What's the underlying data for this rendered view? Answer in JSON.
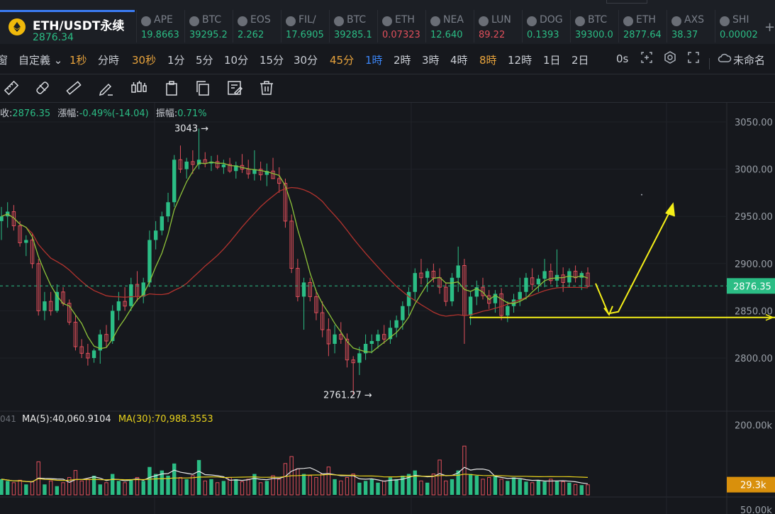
{
  "symbol": {
    "name": "ETH/USDT永续",
    "price": "2876.34"
  },
  "tickers": [
    {
      "name": "APE",
      "price": "19.8663",
      "dir": "up"
    },
    {
      "name": "BTC",
      "price": "39295.2",
      "dir": "up"
    },
    {
      "name": "EOS",
      "price": "2.262",
      "dir": "up"
    },
    {
      "name": "FIL/",
      "price": "17.6905",
      "dir": "up"
    },
    {
      "name": "BTC",
      "price": "39285.1",
      "dir": "up"
    },
    {
      "name": "ETH",
      "price": "0.07323",
      "dir": "down"
    },
    {
      "name": "NEA",
      "price": "12.640",
      "dir": "up"
    },
    {
      "name": "LUN",
      "price": "89.22",
      "dir": "down"
    },
    {
      "name": "DOG",
      "price": "0.1393",
      "dir": "up"
    },
    {
      "name": "BTC",
      "price": "39300.0",
      "dir": "up"
    },
    {
      "name": "ETH",
      "price": "2877.64",
      "dir": "up"
    },
    {
      "name": "AXS",
      "price": "38.37",
      "dir": "up"
    },
    {
      "name": "SHI",
      "price": "0.00002",
      "dir": "up"
    }
  ],
  "intervals": [
    {
      "label": "窗",
      "state": "normal"
    },
    {
      "label": "自定義",
      "state": "normal"
    },
    {
      "label": "1秒",
      "state": "fav"
    },
    {
      "label": "分時",
      "state": "normal"
    },
    {
      "label": "30秒",
      "state": "fav"
    },
    {
      "label": "1分",
      "state": "normal"
    },
    {
      "label": "5分",
      "state": "normal"
    },
    {
      "label": "10分",
      "state": "normal"
    },
    {
      "label": "15分",
      "state": "normal"
    },
    {
      "label": "30分",
      "state": "normal"
    },
    {
      "label": "45分",
      "state": "fav"
    },
    {
      "label": "1時",
      "state": "active"
    },
    {
      "label": "2時",
      "state": "normal"
    },
    {
      "label": "3時",
      "state": "normal"
    },
    {
      "label": "4時",
      "state": "normal"
    },
    {
      "label": "8時",
      "state": "fav"
    },
    {
      "label": "12時",
      "state": "normal"
    },
    {
      "label": "1日",
      "state": "normal"
    },
    {
      "label": "2日",
      "state": "normal"
    },
    {
      "label": "0s",
      "state": "normal"
    }
  ],
  "layout_name": "未命名",
  "tools": [
    "ruler-icon",
    "ruler-alt-icon",
    "measure-icon",
    "pencil-icon",
    "candles-icon",
    "clipboard-icon",
    "copy-icon",
    "edit-icon",
    "trash-icon"
  ],
  "stats": {
    "close_label": "收:",
    "close_value": "2876.35",
    "change_label": "漲幅:",
    "change_value": "-0.49%(-14.04)",
    "amp_label": "振幅:",
    "amp_value": "0.71%"
  },
  "volume_legend": {
    "prefix": "041",
    "ma5_label": "MA(5):",
    "ma5_value": "40,060.9104",
    "ma30_label": "MA(30):",
    "ma30_value": "70,988.3553"
  },
  "annotations": {
    "high_label": "3043",
    "low_label": "2761.27"
  },
  "colors": {
    "up": "#2bbd85",
    "down": "#e04f5b",
    "ma_fast": "#8ec33a",
    "ma_slow": "#b2332e",
    "drawing": "#f5ef18",
    "vol_ma5": "#e8e8e8",
    "vol_ma30": "#e8d21c",
    "price_tag": "#2bbd85",
    "vol_tag": "#d9900c"
  },
  "chart_data": {
    "type": "candlestick",
    "y_axis_ticks": [
      "3050.00",
      "3000.00",
      "2950.00",
      "2900.00",
      "2850.00",
      "2800.00"
    ],
    "ylim": [
      2750,
      3075
    ],
    "current_price_tag": "2876.35",
    "volume_axis_ticks": [
      "200.00k",
      "50.00k"
    ],
    "volume_tag": "29.3k",
    "candles": [
      {
        "o": 2945,
        "h": 2960,
        "l": 2925,
        "c": 2950
      },
      {
        "o": 2950,
        "h": 2965,
        "l": 2938,
        "c": 2955
      },
      {
        "o": 2955,
        "h": 2962,
        "l": 2935,
        "c": 2940
      },
      {
        "o": 2940,
        "h": 2945,
        "l": 2918,
        "c": 2922
      },
      {
        "o": 2922,
        "h": 2930,
        "l": 2908,
        "c": 2925
      },
      {
        "o": 2925,
        "h": 2932,
        "l": 2895,
        "c": 2900
      },
      {
        "o": 2900,
        "h": 2905,
        "l": 2845,
        "c": 2850
      },
      {
        "o": 2850,
        "h": 2870,
        "l": 2840,
        "c": 2860
      },
      {
        "o": 2860,
        "h": 2870,
        "l": 2845,
        "c": 2850
      },
      {
        "o": 2850,
        "h": 2878,
        "l": 2848,
        "c": 2870
      },
      {
        "o": 2870,
        "h": 2875,
        "l": 2855,
        "c": 2858
      },
      {
        "o": 2858,
        "h": 2862,
        "l": 2835,
        "c": 2838
      },
      {
        "o": 2838,
        "h": 2845,
        "l": 2808,
        "c": 2812
      },
      {
        "o": 2812,
        "h": 2820,
        "l": 2800,
        "c": 2805
      },
      {
        "o": 2805,
        "h": 2815,
        "l": 2792,
        "c": 2800
      },
      {
        "o": 2800,
        "h": 2810,
        "l": 2795,
        "c": 2808
      },
      {
        "o": 2808,
        "h": 2830,
        "l": 2794,
        "c": 2825
      },
      {
        "o": 2825,
        "h": 2835,
        "l": 2812,
        "c": 2818
      },
      {
        "o": 2818,
        "h": 2856,
        "l": 2815,
        "c": 2850
      },
      {
        "o": 2850,
        "h": 2870,
        "l": 2840,
        "c": 2860
      },
      {
        "o": 2860,
        "h": 2875,
        "l": 2850,
        "c": 2855
      },
      {
        "o": 2855,
        "h": 2885,
        "l": 2850,
        "c": 2878
      },
      {
        "o": 2878,
        "h": 2892,
        "l": 2860,
        "c": 2865
      },
      {
        "o": 2865,
        "h": 2885,
        "l": 2858,
        "c": 2880
      },
      {
        "o": 2880,
        "h": 2935,
        "l": 2875,
        "c": 2925
      },
      {
        "o": 2925,
        "h": 2945,
        "l": 2915,
        "c": 2935
      },
      {
        "o": 2935,
        "h": 2955,
        "l": 2930,
        "c": 2950
      },
      {
        "o": 2950,
        "h": 2975,
        "l": 2944,
        "c": 2965
      },
      {
        "o": 2965,
        "h": 3015,
        "l": 2960,
        "c": 3010
      },
      {
        "o": 3010,
        "h": 3025,
        "l": 2996,
        "c": 3000
      },
      {
        "o": 3000,
        "h": 3012,
        "l": 2990,
        "c": 3008
      },
      {
        "o": 3008,
        "h": 3020,
        "l": 2995,
        "c": 3005
      },
      {
        "o": 3005,
        "h": 3043,
        "l": 3000,
        "c": 3010
      },
      {
        "o": 3010,
        "h": 3018,
        "l": 3002,
        "c": 3006
      },
      {
        "o": 3006,
        "h": 3014,
        "l": 2998,
        "c": 3008
      },
      {
        "o": 3008,
        "h": 3015,
        "l": 3000,
        "c": 3002
      },
      {
        "o": 3002,
        "h": 3010,
        "l": 2995,
        "c": 3005
      },
      {
        "o": 3005,
        "h": 3012,
        "l": 2996,
        "c": 2998
      },
      {
        "o": 2998,
        "h": 3008,
        "l": 2990,
        "c": 3004
      },
      {
        "o": 3004,
        "h": 3016,
        "l": 2996,
        "c": 3000
      },
      {
        "o": 3000,
        "h": 3010,
        "l": 2990,
        "c": 2995
      },
      {
        "o": 2995,
        "h": 3020,
        "l": 2988,
        "c": 3000
      },
      {
        "o": 3000,
        "h": 3008,
        "l": 2988,
        "c": 2994
      },
      {
        "o": 2994,
        "h": 3006,
        "l": 2982,
        "c": 2998
      },
      {
        "o": 2998,
        "h": 3012,
        "l": 2990,
        "c": 2990
      },
      {
        "o": 2990,
        "h": 3002,
        "l": 2975,
        "c": 2985
      },
      {
        "o": 2985,
        "h": 2990,
        "l": 2938,
        "c": 2945
      },
      {
        "o": 2945,
        "h": 2952,
        "l": 2890,
        "c": 2895
      },
      {
        "o": 2895,
        "h": 2905,
        "l": 2860,
        "c": 2865
      },
      {
        "o": 2865,
        "h": 2885,
        "l": 2830,
        "c": 2880
      },
      {
        "o": 2880,
        "h": 2885,
        "l": 2860,
        "c": 2865
      },
      {
        "o": 2865,
        "h": 2872,
        "l": 2840,
        "c": 2848
      },
      {
        "o": 2848,
        "h": 2860,
        "l": 2822,
        "c": 2830
      },
      {
        "o": 2830,
        "h": 2842,
        "l": 2802,
        "c": 2815
      },
      {
        "o": 2815,
        "h": 2835,
        "l": 2805,
        "c": 2825
      },
      {
        "o": 2825,
        "h": 2838,
        "l": 2815,
        "c": 2820
      },
      {
        "o": 2820,
        "h": 2826,
        "l": 2790,
        "c": 2798
      },
      {
        "o": 2798,
        "h": 2802,
        "l": 2761,
        "c": 2795
      },
      {
        "o": 2795,
        "h": 2812,
        "l": 2782,
        "c": 2805
      },
      {
        "o": 2805,
        "h": 2825,
        "l": 2798,
        "c": 2815
      },
      {
        "o": 2815,
        "h": 2825,
        "l": 2805,
        "c": 2818
      },
      {
        "o": 2818,
        "h": 2830,
        "l": 2810,
        "c": 2825
      },
      {
        "o": 2825,
        "h": 2835,
        "l": 2815,
        "c": 2820
      },
      {
        "o": 2820,
        "h": 2840,
        "l": 2815,
        "c": 2832
      },
      {
        "o": 2832,
        "h": 2845,
        "l": 2822,
        "c": 2840
      },
      {
        "o": 2840,
        "h": 2860,
        "l": 2830,
        "c": 2855
      },
      {
        "o": 2855,
        "h": 2875,
        "l": 2845,
        "c": 2870
      },
      {
        "o": 2870,
        "h": 2895,
        "l": 2860,
        "c": 2890
      },
      {
        "o": 2890,
        "h": 2905,
        "l": 2878,
        "c": 2885
      },
      {
        "o": 2885,
        "h": 2895,
        "l": 2870,
        "c": 2892
      },
      {
        "o": 2892,
        "h": 2900,
        "l": 2880,
        "c": 2885
      },
      {
        "o": 2885,
        "h": 2895,
        "l": 2868,
        "c": 2875
      },
      {
        "o": 2875,
        "h": 2880,
        "l": 2855,
        "c": 2860
      },
      {
        "o": 2860,
        "h": 2890,
        "l": 2855,
        "c": 2885
      },
      {
        "o": 2885,
        "h": 2918,
        "l": 2870,
        "c": 2898
      },
      {
        "o": 2898,
        "h": 2905,
        "l": 2815,
        "c": 2845
      },
      {
        "o": 2845,
        "h": 2870,
        "l": 2835,
        "c": 2865
      },
      {
        "o": 2865,
        "h": 2882,
        "l": 2856,
        "c": 2875
      },
      {
        "o": 2875,
        "h": 2885,
        "l": 2862,
        "c": 2866
      },
      {
        "o": 2866,
        "h": 2872,
        "l": 2852,
        "c": 2858
      },
      {
        "o": 2858,
        "h": 2872,
        "l": 2848,
        "c": 2868
      },
      {
        "o": 2868,
        "h": 2874,
        "l": 2840,
        "c": 2845
      },
      {
        "o": 2845,
        "h": 2860,
        "l": 2838,
        "c": 2855
      },
      {
        "o": 2855,
        "h": 2868,
        "l": 2848,
        "c": 2862
      },
      {
        "o": 2862,
        "h": 2885,
        "l": 2855,
        "c": 2870
      },
      {
        "o": 2870,
        "h": 2890,
        "l": 2862,
        "c": 2885
      },
      {
        "o": 2885,
        "h": 2895,
        "l": 2872,
        "c": 2878
      },
      {
        "o": 2878,
        "h": 2888,
        "l": 2870,
        "c": 2884
      },
      {
        "o": 2884,
        "h": 2905,
        "l": 2875,
        "c": 2892
      },
      {
        "o": 2892,
        "h": 2900,
        "l": 2878,
        "c": 2882
      },
      {
        "o": 2882,
        "h": 2915,
        "l": 2875,
        "c": 2888
      },
      {
        "o": 2888,
        "h": 2896,
        "l": 2870,
        "c": 2880
      },
      {
        "o": 2880,
        "h": 2895,
        "l": 2875,
        "c": 2892
      },
      {
        "o": 2892,
        "h": 2898,
        "l": 2880,
        "c": 2885
      },
      {
        "o": 2885,
        "h": 2892,
        "l": 2872,
        "c": 2890
      },
      {
        "o": 2890,
        "h": 2896,
        "l": 2875,
        "c": 2876
      }
    ],
    "volumes": [
      45,
      40,
      35,
      42,
      30,
      38,
      95,
      30,
      40,
      25,
      35,
      50,
      70,
      40,
      45,
      55,
      30,
      35,
      60,
      40,
      35,
      45,
      50,
      40,
      80,
      60,
      70,
      55,
      90,
      50,
      45,
      55,
      100,
      40,
      45,
      35,
      40,
      50,
      45,
      38,
      45,
      60,
      35,
      40,
      55,
      45,
      90,
      110,
      75,
      60,
      55,
      50,
      60,
      80,
      45,
      40,
      50,
      60,
      35,
      40,
      45,
      35,
      40,
      50,
      45,
      55,
      60,
      70,
      40,
      35,
      60,
      100,
      40,
      45,
      70,
      140,
      60,
      55,
      45,
      50,
      55,
      45,
      40,
      50,
      45,
      38,
      35,
      42,
      38,
      45,
      40,
      38,
      35,
      30,
      28,
      29
    ]
  }
}
